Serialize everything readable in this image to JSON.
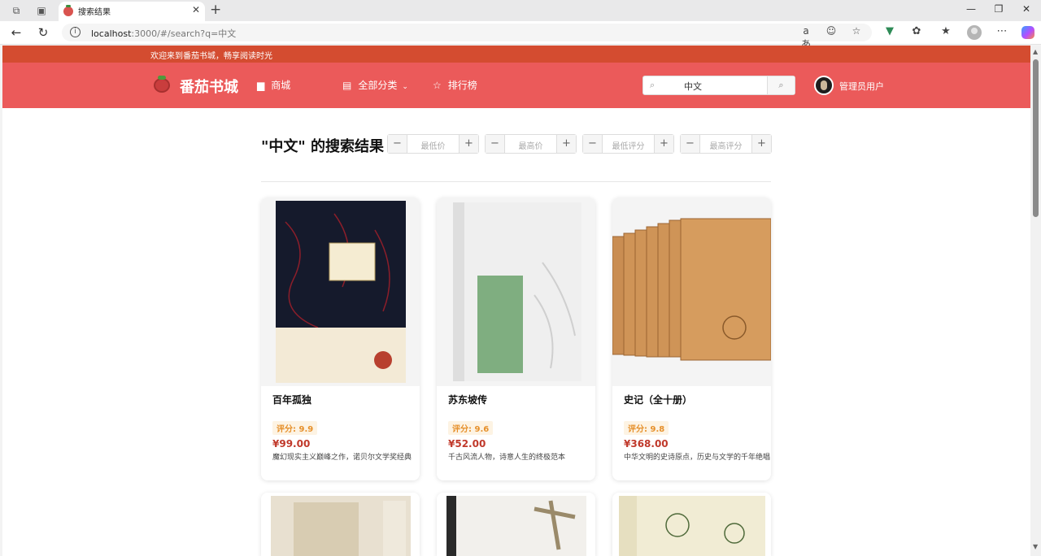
{
  "browser": {
    "tab_title": "搜索结果",
    "url_host": "localhost",
    "url_rest": ":3000/#/search?q=中文"
  },
  "site": {
    "welcome": "欢迎来到番茄书城，畅享阅读时光",
    "logo_text": "番茄书城",
    "nav": [
      {
        "label": "商城"
      },
      {
        "label": "全部分类"
      },
      {
        "label": "排行榜"
      }
    ],
    "search_value": "中文",
    "user_name": "管理员用户"
  },
  "results": {
    "title": "\"中文\" 的搜索结果",
    "filters": [
      {
        "placeholder": "最低价"
      },
      {
        "placeholder": "最高价"
      },
      {
        "placeholder": "最低评分"
      },
      {
        "placeholder": "最高评分"
      }
    ],
    "books": [
      {
        "title": "百年孤独",
        "rating": "评分: 9.9",
        "price": "¥99.00",
        "desc": "魔幻现实主义巅峰之作，诺贝尔文学奖经典"
      },
      {
        "title": "苏东坡传",
        "rating": "评分: 9.6",
        "price": "¥52.00",
        "desc": "千古风流人物，诗意人生的终极范本"
      },
      {
        "title": "史记（全十册）",
        "rating": "评分: 9.8",
        "price": "¥368.00",
        "desc": "中华文明的史诗原点，历史与文学的千年绝唱"
      }
    ]
  },
  "colors": {
    "header": "#eb5a5a",
    "welcome_bar": "#d44c30",
    "price": "#c0392b",
    "rating": "#e6902b"
  }
}
